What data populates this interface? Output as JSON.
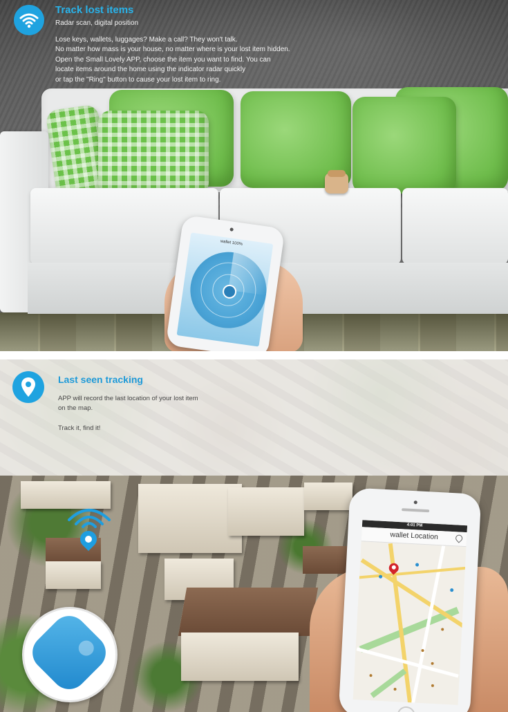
{
  "panel1": {
    "title": "Track lost items",
    "subtitle": "Radar scan, digital position",
    "body": [
      "Lose keys, wallets, luggages? Make a call? They won't talk.",
      "No matter how mass is your house, no matter where is your lost item hidden.",
      "Open the Small Lovely APP, choose the item you want to find. You can",
      "locate items around the home using the indicator radar quickly",
      "or tap the \"Ring\" button to cause your lost item to ring."
    ],
    "icon": "wifi-icon",
    "phone_title": "wallet  100%"
  },
  "panel2": {
    "title": "Last seen tracking",
    "body_line1": "APP will record the last location of your lost item",
    "body_line2": "on the map.",
    "body_line3": "Track it, find it!",
    "icon": "location-pin-icon",
    "phone": {
      "status_time": "4:01 PM",
      "map_title": "wallet Location"
    }
  },
  "colors": {
    "accent": "#1fa3e0",
    "pin_red": "#d2232a"
  }
}
